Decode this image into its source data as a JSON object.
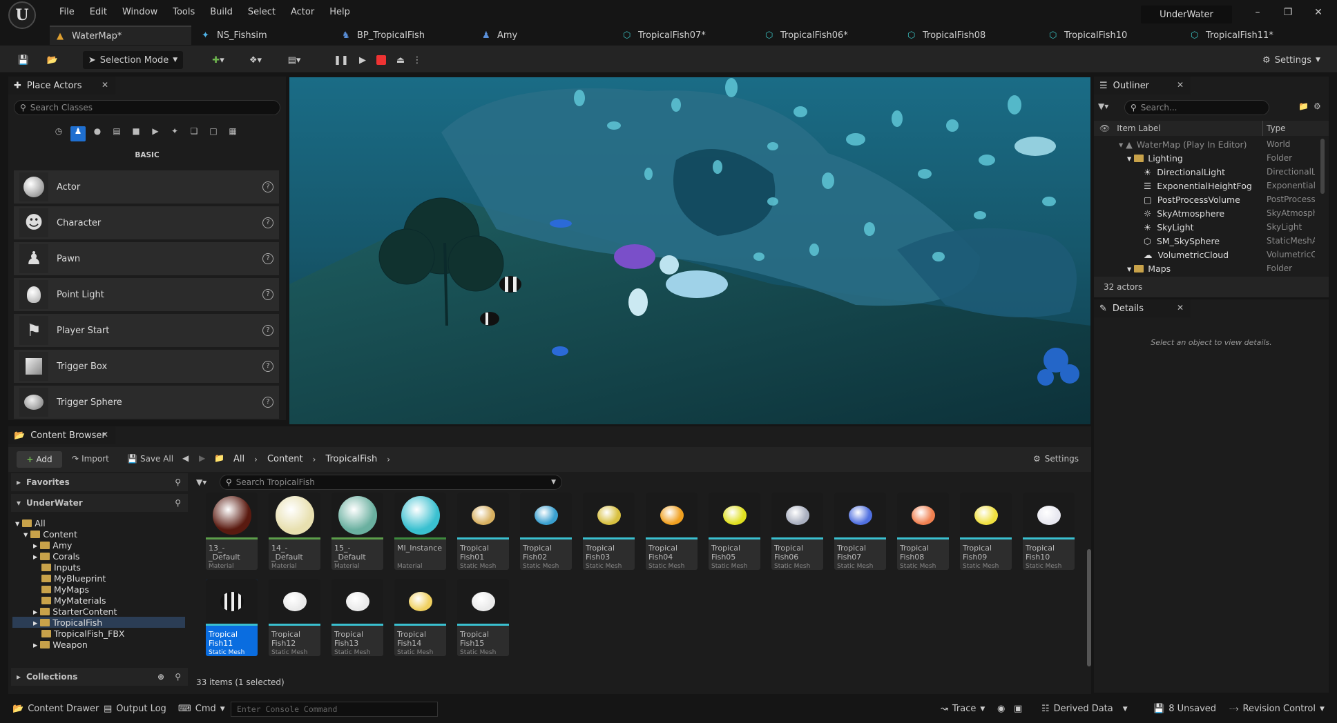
{
  "app": {
    "project_name": "UnderWater",
    "menu": [
      "File",
      "Edit",
      "Window",
      "Tools",
      "Build",
      "Select",
      "Actor",
      "Help"
    ]
  },
  "tabs": [
    {
      "label": "WaterMap*",
      "icon": "level-icon"
    },
    {
      "label": "NS_Fishsim",
      "icon": "niagara-icon"
    },
    {
      "label": "BP_TropicalFish",
      "icon": "blueprint-icon"
    },
    {
      "label": "Amy",
      "icon": "skeleton-icon"
    },
    {
      "label": "TropicalFish07*",
      "icon": "static-mesh-icon"
    },
    {
      "label": "TropicalFish06*",
      "icon": "static-mesh-icon"
    },
    {
      "label": "TropicalFish08",
      "icon": "static-mesh-icon"
    },
    {
      "label": "TropicalFish10",
      "icon": "static-mesh-icon"
    },
    {
      "label": "TropicalFish11*",
      "icon": "static-mesh-icon"
    }
  ],
  "toolbar": {
    "selection_mode": "Selection Mode",
    "settings": "Settings"
  },
  "place_actors": {
    "title": "Place Actors",
    "search_placeholder": "Search Classes",
    "category": "BASIC",
    "items": [
      "Actor",
      "Character",
      "Pawn",
      "Point Light",
      "Player Start",
      "Trigger Box",
      "Trigger Sphere"
    ]
  },
  "outliner": {
    "title": "Outliner",
    "search_placeholder": "Search...",
    "col_label": "Item Label",
    "col_type": "Type",
    "rows": [
      {
        "label": "WaterMap (Play In Editor)",
        "type": "World"
      },
      {
        "label": "Lighting",
        "type": "Folder"
      },
      {
        "label": "DirectionalLight",
        "type": "DirectionalLig"
      },
      {
        "label": "ExponentialHeightFog",
        "type": "ExponentialHe"
      },
      {
        "label": "PostProcessVolume",
        "type": "PostProcessV"
      },
      {
        "label": "SkyAtmosphere",
        "type": "SkyAtmosphe"
      },
      {
        "label": "SkyLight",
        "type": "SkyLight"
      },
      {
        "label": "SM_SkySphere",
        "type": "StaticMeshAc"
      },
      {
        "label": "VolumetricCloud",
        "type": "VolumetricClo"
      },
      {
        "label": "Maps",
        "type": "Folder"
      }
    ],
    "count": "32 actors"
  },
  "details": {
    "title": "Details",
    "empty": "Select an object to view details."
  },
  "content_browser": {
    "title": "Content Browser",
    "add": "Add",
    "import": "Import",
    "save_all": "Save All",
    "breadcrumb": [
      "All",
      "Content",
      "TropicalFish"
    ],
    "settings": "Settings",
    "search_placeholder": "Search TropicalFish",
    "favorites": "Favorites",
    "root": "UnderWater",
    "collections": "Collections",
    "tree": [
      "All",
      "Content",
      "Amy",
      "Corals",
      "Inputs",
      "MyBlueprint",
      "MyMaps",
      "MyMaterials",
      "StarterContent",
      "TropicalFish",
      "TropicalFish_FBX",
      "Weapon"
    ],
    "assets": [
      {
        "name": "13_-_Default",
        "kind": "Material"
      },
      {
        "name": "14_-_Default",
        "kind": "Material"
      },
      {
        "name": "15_-_Default",
        "kind": "Material"
      },
      {
        "name": "MI_Instance",
        "kind": "Material Instance"
      },
      {
        "name": "Tropical Fish01",
        "kind": "Static Mesh"
      },
      {
        "name": "Tropical Fish02",
        "kind": "Static Mesh"
      },
      {
        "name": "Tropical Fish03",
        "kind": "Static Mesh"
      },
      {
        "name": "Tropical Fish04",
        "kind": "Static Mesh"
      },
      {
        "name": "Tropical Fish05",
        "kind": "Static Mesh"
      },
      {
        "name": "Tropical Fish06",
        "kind": "Static Mesh"
      },
      {
        "name": "Tropical Fish07",
        "kind": "Static Mesh"
      },
      {
        "name": "Tropical Fish08",
        "kind": "Static Mesh"
      },
      {
        "name": "Tropical Fish09",
        "kind": "Static Mesh"
      },
      {
        "name": "Tropical Fish10",
        "kind": "Static Mesh"
      },
      {
        "name": "Tropical Fish11",
        "kind": "Static Mesh"
      },
      {
        "name": "Tropical Fish12",
        "kind": "Static Mesh"
      },
      {
        "name": "Tropical Fish13",
        "kind": "Static Mesh"
      },
      {
        "name": "Tropical Fish14",
        "kind": "Static Mesh"
      },
      {
        "name": "Tropical Fish15",
        "kind": "Static Mesh"
      }
    ],
    "status": "33 items (1 selected)"
  },
  "statusbar": {
    "content_drawer": "Content Drawer",
    "output_log": "Output Log",
    "cmd": "Cmd",
    "console_placeholder": "Enter Console Command",
    "trace": "Trace",
    "derived_data": "Derived Data",
    "unsaved": "8 Unsaved",
    "revision_control": "Revision Control"
  }
}
